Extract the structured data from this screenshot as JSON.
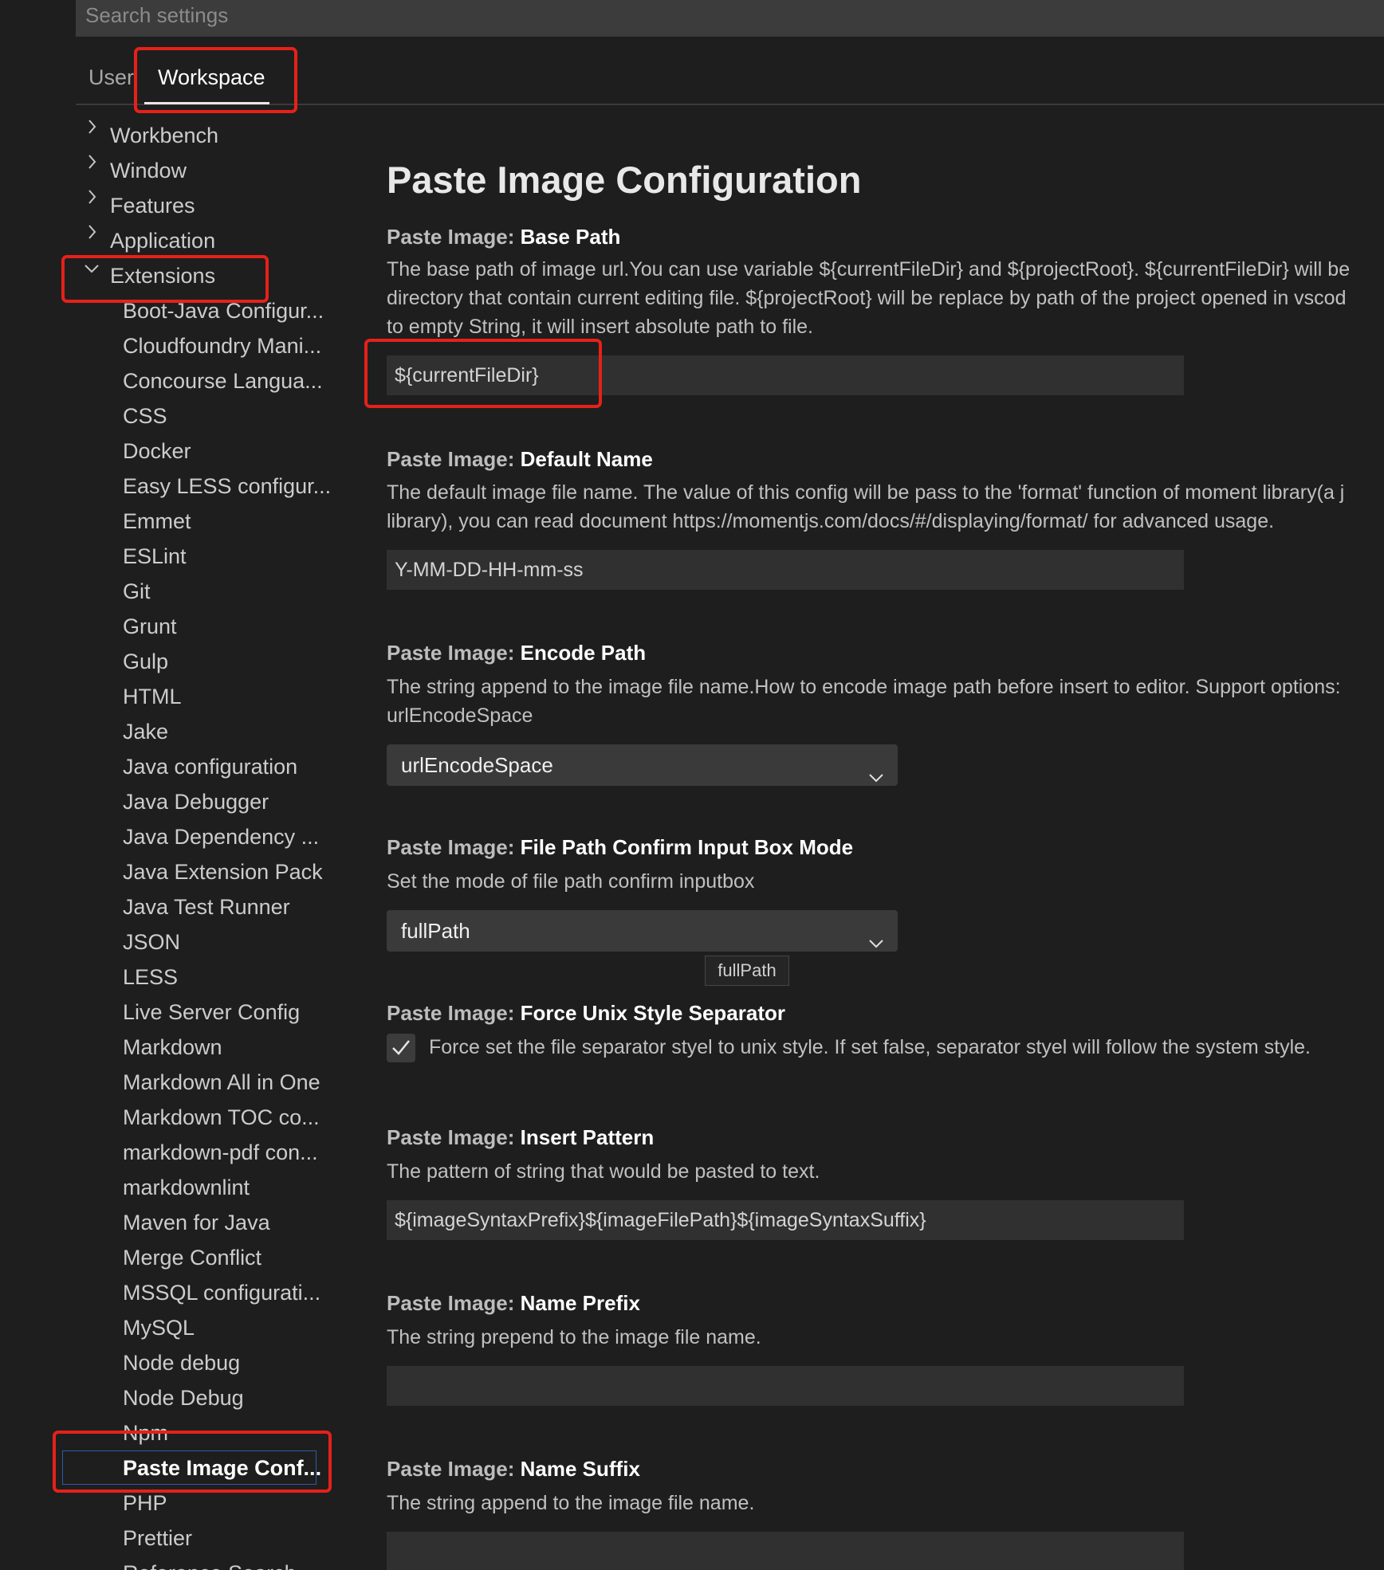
{
  "search": {
    "placeholder": "Search settings"
  },
  "tabs": {
    "user": "User",
    "workspace": "Workspace"
  },
  "nav": {
    "top": [
      {
        "label": "Workbench",
        "state": "collapsed"
      },
      {
        "label": "Window",
        "state": "collapsed"
      },
      {
        "label": "Features",
        "state": "collapsed"
      },
      {
        "label": "Application",
        "state": "collapsed"
      },
      {
        "label": "Extensions",
        "state": "expanded"
      }
    ],
    "extensions": [
      "Boot-Java Configur...",
      "Cloudfoundry Mani...",
      "Concourse Langua...",
      "CSS",
      "Docker",
      "Easy LESS configur...",
      "Emmet",
      "ESLint",
      "Git",
      "Grunt",
      "Gulp",
      "HTML",
      "Jake",
      "Java configuration",
      "Java Debugger",
      "Java Dependency ...",
      "Java Extension Pack",
      "Java Test Runner",
      "JSON",
      "LESS",
      "Live Server Config",
      "Markdown",
      "Markdown All in One",
      "Markdown TOC co...",
      "markdown-pdf con...",
      "markdownlint",
      "Maven for Java",
      "Merge Conflict",
      "MSSQL configurati...",
      "MySQL",
      "Node debug",
      "Node Debug",
      "Npm",
      "Paste Image Conf...",
      "PHP",
      "Prettier",
      "Reference Search..."
    ],
    "selected": "Paste Image Conf..."
  },
  "main": {
    "title": "Paste Image Configuration",
    "settings": {
      "base_path": {
        "category": "Paste Image: ",
        "key": "Base Path",
        "desc": [
          "The base path of image url.You can use variable ${currentFileDir} and ${projectRoot}. ${currentFileDir} will be",
          "directory that contain current editing file. ${projectRoot} will be replace by path of the project opened in vscod",
          "to empty String, it will insert absolute path to file."
        ],
        "value": "${currentFileDir}"
      },
      "default_name": {
        "category": "Paste Image: ",
        "key": "Default Name",
        "desc": [
          "The default image file name. The value of this config will be pass to the 'format' function of moment library(a j",
          "library), you can read document https://momentjs.com/docs/#/displaying/format/ for advanced usage."
        ],
        "value": "Y-MM-DD-HH-mm-ss"
      },
      "encode_path": {
        "category": "Paste Image: ",
        "key": "Encode Path",
        "desc": [
          "The string append to the image file name.How to encode image path before insert to editor. Support options:",
          "urlEncodeSpace"
        ],
        "value": "urlEncodeSpace"
      },
      "confirm_mode": {
        "category": "Paste Image: ",
        "key": "File Path Confirm Input Box Mode",
        "desc": "Set the mode of file path confirm inputbox",
        "value": "fullPath",
        "tooltip": "fullPath"
      },
      "unix_separator": {
        "category": "Paste Image: ",
        "key": "Force Unix Style Separator",
        "label": "Force set the file separator styel to unix style. If set false, separator styel will follow the system style.",
        "checked": true
      },
      "insert_pattern": {
        "category": "Paste Image: ",
        "key": "Insert Pattern",
        "desc": "The pattern of string that would be pasted to text.",
        "value": "${imageSyntaxPrefix}${imageFilePath}${imageSyntaxSuffix}"
      },
      "name_prefix": {
        "category": "Paste Image: ",
        "key": "Name Prefix",
        "desc": "The string prepend to the image file name.",
        "value": ""
      },
      "name_suffix": {
        "category": "Paste Image: ",
        "key": "Name Suffix",
        "desc": "The string append to the image file name.",
        "value": ""
      }
    }
  },
  "colors": {
    "background": "#1e1e1e",
    "annotation_red": "#e5211a",
    "selection_border": "#2b5ca8"
  }
}
